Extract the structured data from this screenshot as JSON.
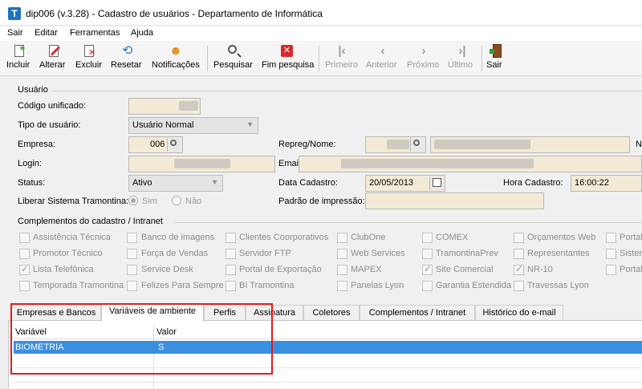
{
  "window": {
    "title": "dip006 (v.3.28) - Cadastro de usuários - Departamento de Informática",
    "icon_letter": "T"
  },
  "menu": [
    "Sair",
    "Editar",
    "Ferramentas",
    "Ajuda"
  ],
  "toolbar": {
    "incluir": "Incluir",
    "alterar": "Alterar",
    "excluir": "Excluir",
    "resetar": "Resetar",
    "notificacoes": "Notificações",
    "pesquisar": "Pesquisar",
    "fim_pesquisa": "Fim pesquisa",
    "primeiro": "Primeiro",
    "anterior": "Anterior",
    "proximo": "Próximo",
    "ultimo": "Último",
    "sair": "Sair"
  },
  "usuario": {
    "group_title": "Usuário",
    "codigo_label": "Código unificado:",
    "tipo_label": "Tipo de usuário:",
    "tipo_value": "Usuário Normal",
    "empresa_label": "Empresa:",
    "empresa_value": "006",
    "repreg_label": "Repreg/Nome:",
    "login_label": "Login:",
    "email_label": "Email:",
    "status_label": "Status:",
    "status_value": "Ativo",
    "data_cadastro_label": "Data Cadastro:",
    "data_cadastro_value": "20/05/2013",
    "hora_cadastro_label": "Hora Cadastro:",
    "hora_cadastro_value": "16:00:22",
    "liberar_label": "Liberar Sistema Tramontina:",
    "sim": "Sim",
    "nao": "Não",
    "padrao_label": "Padrão de impressão:",
    "edge_letter": "N"
  },
  "complementos": {
    "group_title": "Complementos do cadastro / Intranet",
    "row1": [
      "Assistência Técnica",
      "Banco de imagens",
      "Clientes Coorporativos",
      "ClubOne",
      "COMEX",
      "Orçamentos Web",
      "Portal"
    ],
    "row2": [
      "Promotor Técnico",
      "Força de Vendas",
      "Servidor FTP",
      "Web Services",
      "TramontinaPrev",
      "Representantes",
      "Sisten"
    ],
    "row3": [
      "Lista Telefônica",
      "Service Desk",
      "Portal de Exportação",
      "MAPEX",
      "Site Comercial",
      "NR-10",
      "Portal"
    ],
    "row4": [
      "Temporada Tramontina",
      "Felizes Para Sempre",
      "BI Tramontina",
      "Panelas Lyon",
      "Garantia Estendida",
      "Travessas Lyon"
    ]
  },
  "tabs": [
    "Empresas e Bancos",
    "Variáveis de ambiente",
    "Perfis",
    "Assinatura",
    "Coletores",
    "Complementos / Intranet",
    "Histórico do e-mail"
  ],
  "grid": {
    "columns": [
      "Variável",
      "Valor"
    ],
    "rows": [
      {
        "variavel": "BIOMETRIA",
        "valor": "S"
      }
    ]
  },
  "colors": {
    "selection": "#3b8fdf",
    "highlight_box": "#e01e1e",
    "field_bg": "#f3ead6"
  }
}
